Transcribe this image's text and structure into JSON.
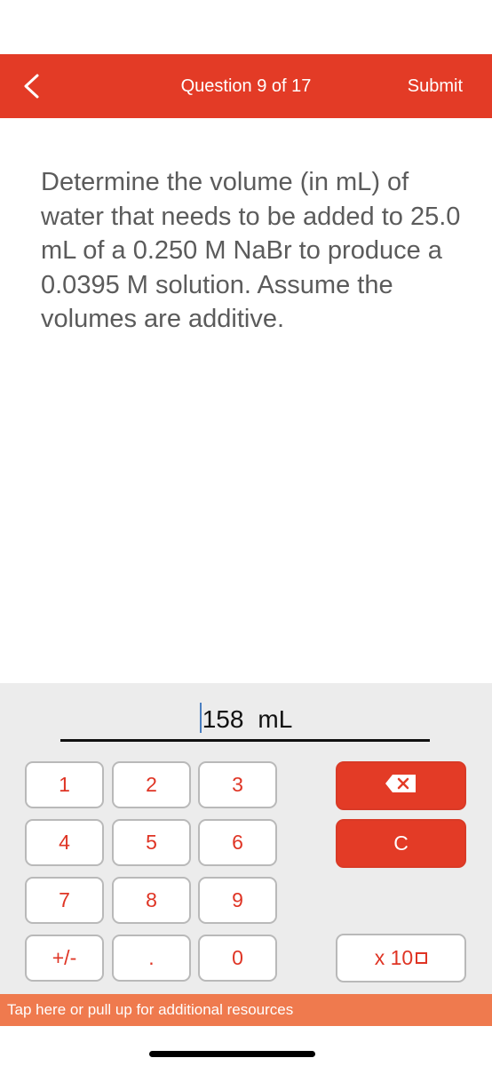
{
  "header": {
    "back_icon": "chevron-left-icon",
    "title": "Question 9 of 17",
    "submit_label": "Submit"
  },
  "question": {
    "text": "Determine the volume (in mL) of water that needs to be added to 25.0 mL of a 0.250 M NaBr to produce a 0.0395 M solution. Assume the volumes are additive."
  },
  "answer": {
    "value": "158",
    "unit": "mL"
  },
  "keypad": {
    "keys": [
      "1",
      "2",
      "3",
      "4",
      "5",
      "6",
      "7",
      "8",
      "9",
      "+/-",
      ".",
      "0"
    ],
    "backspace_icon": "backspace-icon",
    "clear_label": "C",
    "sci_label": "x 10"
  },
  "resources_bar": {
    "label": "Tap here or pull up for additional resources"
  },
  "colors": {
    "accent": "#e33b26",
    "resources_bar": "#ef7a4e",
    "keypad_bg": "#ececec",
    "key_text": "#df3424"
  }
}
